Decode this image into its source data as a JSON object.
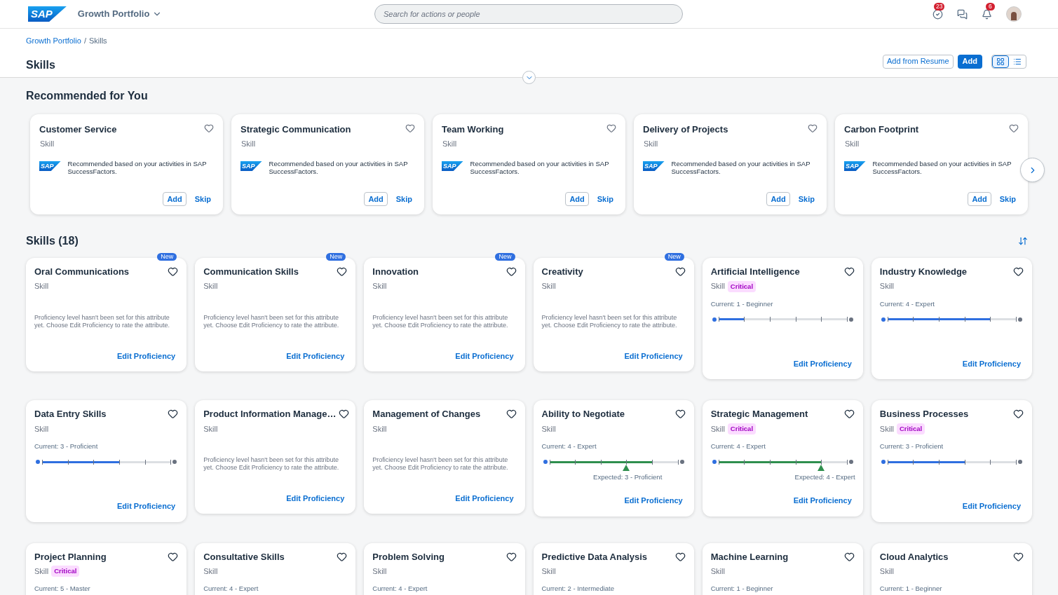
{
  "header": {
    "logo": "SAP",
    "app_title": "Growth Portfolio",
    "search": {
      "placeholder": "Search for actions or people"
    },
    "tasks_count": "23",
    "notifications_count": "6"
  },
  "breadcrumb": {
    "items": [
      "Growth Portfolio",
      "Skills"
    ],
    "separator": "/"
  },
  "page_title": "Skills",
  "actions": [
    "Add from Resume",
    "Add"
  ],
  "views": [
    {
      "kind": "grid",
      "selected": true
    },
    {
      "kind": "list",
      "selected": false
    }
  ],
  "recommended": {
    "title": "Recommended for You",
    "cards": [
      {
        "name": "Customer Service",
        "type": "Skill",
        "logo": "SAP",
        "note": "Recommended based on your activities in SAP SuccessFactors.",
        "add": "Add",
        "skip": "Skip"
      },
      {
        "name": "Strategic Communication",
        "type": "Skill",
        "logo": "SAP",
        "note": "Recommended based on your activities in SAP SuccessFactors.",
        "add": "Add",
        "skip": "Skip"
      },
      {
        "name": "Team Working",
        "type": "Skill",
        "logo": "SAP",
        "note": "Recommended based on your activities in SAP SuccessFactors.",
        "add": "Add",
        "skip": "Skip"
      },
      {
        "name": "Delivery of Projects",
        "type": "Skill",
        "logo": "SAP",
        "note": "Recommended based on your activities in SAP SuccessFactors.",
        "add": "Add",
        "skip": "Skip"
      },
      {
        "name": "Carbon Footprint",
        "type": "Skill",
        "logo": "SAP",
        "note": "Recommended based on your activities in SAP SuccessFactors.",
        "add": "Add",
        "skip": "Skip"
      }
    ]
  },
  "skills": {
    "title": "Skills (18)",
    "cards": [
      {
        "name": "Oral Communications",
        "type": "Skill",
        "badge": "New",
        "note": "Proficiency level hasn't been set for this attribute yet. Choose Edit Proficiency to rate the attribute.",
        "action": "Edit Proficiency"
      },
      {
        "name": "Communication Skills",
        "type": "Skill",
        "badge": "New",
        "note": "Proficiency level hasn't been set for this attribute yet. Choose Edit Proficiency to rate the attribute.",
        "action": "Edit Proficiency"
      },
      {
        "name": "Innovation",
        "type": "Skill",
        "badge": "New",
        "note": "Proficiency level hasn't been set for this attribute yet. Choose Edit Proficiency to rate the attribute.",
        "action": "Edit Proficiency"
      },
      {
        "name": "Creativity",
        "type": "Skill",
        "badge": "New",
        "note": "Proficiency level hasn't been set for this attribute yet. Choose Edit Proficiency to rate the attribute.",
        "action": "Edit Proficiency"
      },
      {
        "name": "Artificial Intelligence",
        "type": "Skill",
        "tag": "Critical",
        "current": "Current: 1 - Beginner",
        "level": 0.2,
        "action": "Edit Proficiency"
      },
      {
        "name": "Industry Knowledge",
        "type": "Skill",
        "current": "Current: 4 - Expert",
        "level": 0.8,
        "action": "Edit Proficiency"
      },
      {
        "name": "Data Entry Skills",
        "type": "Skill",
        "current": "Current: 3 - Proficient",
        "level": 0.6,
        "action": "Edit Proficiency"
      },
      {
        "name": "Product Information Manage…",
        "type": "Skill",
        "note": "Proficiency level hasn't been set for this attribute yet. Choose Edit Proficiency to rate the attribute.",
        "action": "Edit Proficiency"
      },
      {
        "name": "Management of Changes",
        "type": "Skill",
        "note": "Proficiency level hasn't been set for this attribute yet. Choose Edit Proficiency to rate the attribute.",
        "action": "Edit Proficiency"
      },
      {
        "name": "Ability to Negotiate",
        "type": "Skill",
        "current": "Current: 4 - Expert",
        "level": 0.8,
        "expected": {
          "label": "Expected: 3 - Proficient",
          "level": 0.6
        },
        "action": "Edit Proficiency"
      },
      {
        "name": "Strategic Management",
        "type": "Skill",
        "tag": "Critical",
        "current": "Current: 4 - Expert",
        "level": 0.8,
        "expected": {
          "label": "Expected: 4 - Expert",
          "level": 0.8
        },
        "action": "Edit Proficiency"
      },
      {
        "name": "Business Processes",
        "type": "Skill",
        "tag": "Critical",
        "current": "Current: 3 - Proficient",
        "level": 0.6,
        "action": "Edit Proficiency"
      },
      {
        "name": "Project Planning",
        "type": "Skill",
        "tag": "Critical",
        "current": "Current: 5 - Master"
      },
      {
        "name": "Consultative Skills",
        "type": "Skill",
        "current": "Current: 4 - Expert"
      },
      {
        "name": "Problem Solving",
        "type": "Skill",
        "current": "Current: 4 - Expert"
      },
      {
        "name": "Predictive Data Analysis",
        "type": "Skill",
        "current": "Current: 2 - Intermediate"
      },
      {
        "name": "Machine Learning",
        "type": "Skill",
        "current": "Current: 1 - Beginner"
      },
      {
        "name": "Cloud Analytics",
        "type": "Skill",
        "current": "Current: 1 - Beginner"
      }
    ]
  }
}
